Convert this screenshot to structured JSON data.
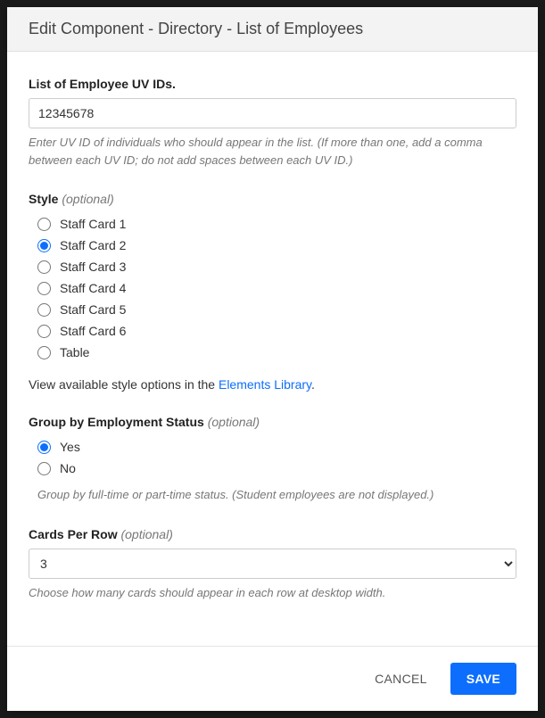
{
  "modal": {
    "title": "Edit Component - Directory - List of Employees"
  },
  "uvid": {
    "label": "List of Employee UV IDs.",
    "value": "12345678",
    "help": "Enter UV ID of individuals who should appear in the list. (If more than one, add a comma between each UV ID; do not add spaces between each UV ID.)"
  },
  "style": {
    "label": "Style",
    "optional": "(optional)",
    "options": [
      {
        "label": "Staff Card 1",
        "selected": false
      },
      {
        "label": "Staff Card 2",
        "selected": true
      },
      {
        "label": "Staff Card 3",
        "selected": false
      },
      {
        "label": "Staff Card 4",
        "selected": false
      },
      {
        "label": "Staff Card 5",
        "selected": false
      },
      {
        "label": "Staff Card 6",
        "selected": false
      },
      {
        "label": "Table",
        "selected": false
      }
    ],
    "hint_prefix": "View available style options in the ",
    "hint_link": "Elements Library",
    "hint_suffix": "."
  },
  "group": {
    "label": "Group by Employment Status",
    "optional": "(optional)",
    "options": [
      {
        "label": "Yes",
        "selected": true
      },
      {
        "label": "No",
        "selected": false
      }
    ],
    "help": "Group by full-time or part-time status. (Student employees are not displayed.)"
  },
  "cards": {
    "label": "Cards Per Row",
    "optional": "(optional)",
    "value": "3",
    "help": "Choose how many cards should appear in each row at desktop width."
  },
  "footer": {
    "cancel": "CANCEL",
    "save": "SAVE"
  }
}
